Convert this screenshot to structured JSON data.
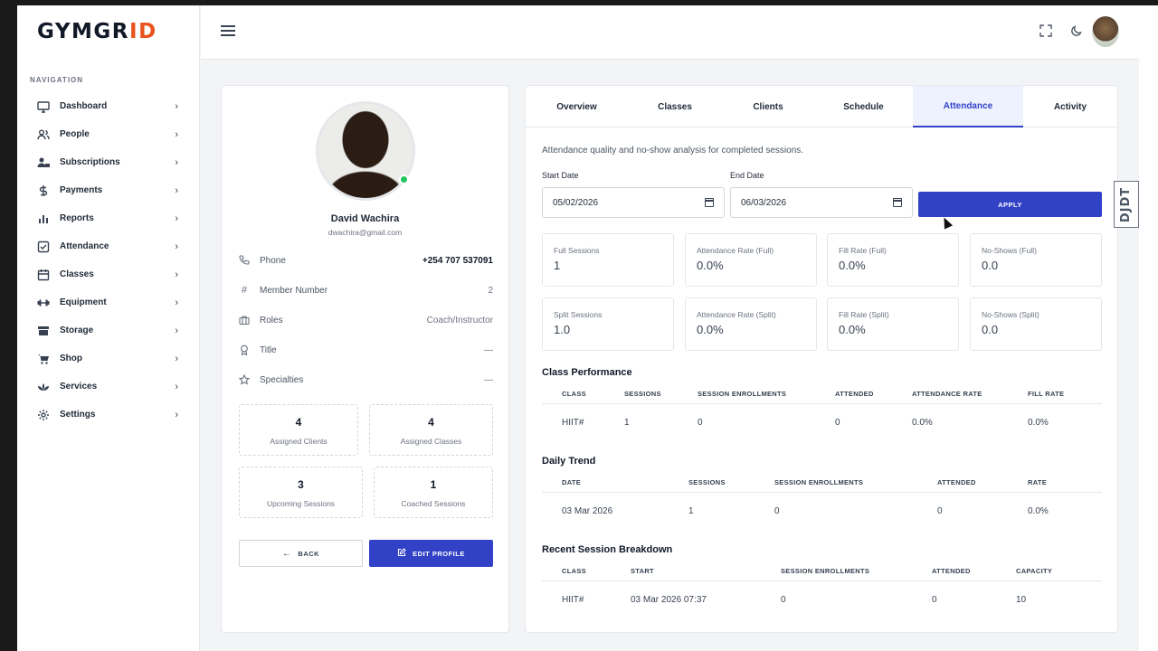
{
  "app": {
    "logo_prefix": "GYMGR",
    "logo_accent": "I",
    "logo_suffix": "D",
    "accent_color": "#e8531e",
    "primary_color": "#3242c6"
  },
  "sidebar": {
    "heading": "NAVIGATION",
    "items": [
      {
        "label": "Dashboard",
        "icon": "monitor-icon"
      },
      {
        "label": "People",
        "icon": "users-icon"
      },
      {
        "label": "Subscriptions",
        "icon": "user-card-icon"
      },
      {
        "label": "Payments",
        "icon": "dollar-icon"
      },
      {
        "label": "Reports",
        "icon": "bar-chart-icon"
      },
      {
        "label": "Attendance",
        "icon": "checkbox-icon"
      },
      {
        "label": "Classes",
        "icon": "calendar-icon"
      },
      {
        "label": "Equipment",
        "icon": "dumbbell-icon"
      },
      {
        "label": "Storage",
        "icon": "storage-icon"
      },
      {
        "label": "Shop",
        "icon": "cart-icon"
      },
      {
        "label": "Services",
        "icon": "lotus-icon"
      },
      {
        "label": "Settings",
        "icon": "gear-icon"
      }
    ]
  },
  "profile": {
    "name": "David Wachira",
    "email": "dwachira@gmail.com",
    "fields": [
      {
        "key": "Phone",
        "value": "+254 707 537091",
        "icon": "phone-icon"
      },
      {
        "key": "Member Number",
        "value": "2",
        "icon": "hash-icon"
      },
      {
        "key": "Roles",
        "value": "Coach/Instructor",
        "icon": "briefcase-icon"
      },
      {
        "key": "Title",
        "value": "—",
        "icon": "award-icon"
      },
      {
        "key": "Specialties",
        "value": "—",
        "icon": "star-icon"
      }
    ],
    "stats": [
      {
        "value": "4",
        "label": "Assigned Clients"
      },
      {
        "value": "4",
        "label": "Assigned Classes"
      },
      {
        "value": "3",
        "label": "Upcoming Sessions"
      },
      {
        "value": "1",
        "label": "Coached Sessions"
      }
    ],
    "back_label": "BACK",
    "edit_label": "EDIT PROFILE"
  },
  "tabs": [
    "Overview",
    "Classes",
    "Clients",
    "Schedule",
    "Attendance",
    "Activity"
  ],
  "active_tab": "Attendance",
  "attendance": {
    "description": "Attendance quality and no-show analysis for completed sessions.",
    "start_label": "Start Date",
    "start_value": "05/02/2026",
    "end_label": "End Date",
    "end_value": "06/03/2026",
    "apply_label": "APPLY",
    "metrics": [
      {
        "label": "Full Sessions",
        "value": "1"
      },
      {
        "label": "Attendance Rate (Full)",
        "value": "0.0%"
      },
      {
        "label": "Fill Rate (Full)",
        "value": "0.0%"
      },
      {
        "label": "No-Shows (Full)",
        "value": "0.0"
      },
      {
        "label": "Split Sessions",
        "value": "1.0"
      },
      {
        "label": "Attendance Rate (Split)",
        "value": "0.0%"
      },
      {
        "label": "Fill Rate (Split)",
        "value": "0.0%"
      },
      {
        "label": "No-Shows (Split)",
        "value": "0.0"
      }
    ],
    "class_performance": {
      "title": "Class Performance",
      "headers": [
        "CLASS",
        "SESSIONS",
        "SESSION ENROLLMENTS",
        "ATTENDED",
        "ATTENDANCE RATE",
        "FILL RATE"
      ],
      "rows": [
        [
          "HIIT#",
          "1",
          "0",
          "0",
          "0.0%",
          "0.0%"
        ]
      ]
    },
    "daily_trend": {
      "title": "Daily Trend",
      "headers": [
        "DATE",
        "SESSIONS",
        "SESSION ENROLLMENTS",
        "ATTENDED",
        "RATE"
      ],
      "rows": [
        [
          "03 Mar 2026",
          "1",
          "0",
          "0",
          "0.0%"
        ]
      ]
    },
    "recent_sessions": {
      "title": "Recent Session Breakdown",
      "headers": [
        "CLASS",
        "START",
        "SESSION ENROLLMENTS",
        "ATTENDED",
        "CAPACITY"
      ],
      "rows": [
        [
          "HIIT#",
          "03 Mar 2026 07:37",
          "0",
          "0",
          "10"
        ]
      ]
    }
  },
  "debug_toolbar": {
    "label": "DJDT"
  }
}
